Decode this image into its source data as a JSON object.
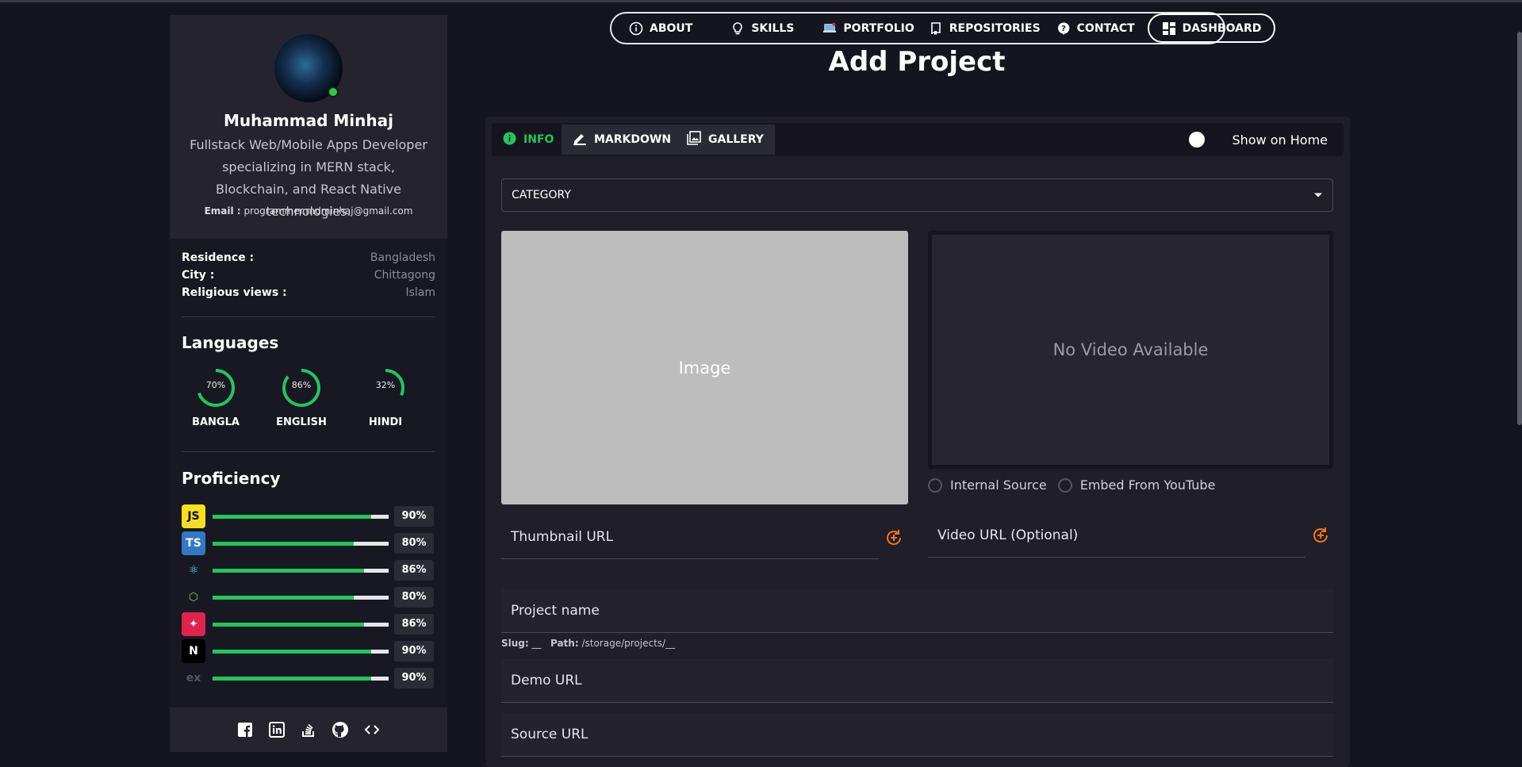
{
  "profile": {
    "name": "Muhammad Minhaj",
    "description": "Fullstack Web/Mobile Apps Developer specializing in MERN stack, Blockchain, and React Native technologies.",
    "email_label": "Email :",
    "email": "programmer.mdminhaj@gmail.com",
    "status": "online"
  },
  "details": [
    {
      "key": "Residence :",
      "value": "Bangladesh"
    },
    {
      "key": "City :",
      "value": "Chittagong"
    },
    {
      "key": "Religious views :",
      "value": "Islam"
    }
  ],
  "languages": {
    "title": "Languages",
    "items": [
      {
        "name": "BANGLA",
        "percent_label": "70%",
        "percent": 70
      },
      {
        "name": "ENGLISH",
        "percent_label": "86%",
        "percent": 86
      },
      {
        "name": "HINDI",
        "percent_label": "32%",
        "percent": 32
      }
    ]
  },
  "proficiency": {
    "title": "Proficiency",
    "items": [
      {
        "icon": "javascript-icon",
        "glyph": "JS",
        "color": "#f7df1e",
        "fg": "#000000",
        "percent_label": "90%",
        "percent": 90
      },
      {
        "icon": "typescript-icon",
        "glyph": "TS",
        "color": "#3178c6",
        "fg": "#ffffff",
        "percent_label": "80%",
        "percent": 80
      },
      {
        "icon": "react-icon",
        "glyph": "⚛",
        "color": "#181822",
        "fg": "#61dafb",
        "percent_label": "86%",
        "percent": 86
      },
      {
        "icon": "nodejs-icon",
        "glyph": "⬡",
        "color": "#181822",
        "fg": "#8cc84b",
        "percent_label": "80%",
        "percent": 80
      },
      {
        "icon": "nestjs-icon",
        "glyph": "✦",
        "color": "#e0234e",
        "fg": "#ffffff",
        "percent_label": "86%",
        "percent": 86
      },
      {
        "icon": "nextjs-icon",
        "glyph": "N",
        "color": "#000000",
        "fg": "#ffffff",
        "percent_label": "90%",
        "percent": 90
      },
      {
        "icon": "express-icon",
        "glyph": "ex",
        "color": "#181822",
        "fg": "#555560",
        "percent_label": "90%",
        "percent": 90
      }
    ]
  },
  "social": [
    "facebook-icon",
    "linkedin-icon",
    "stackoverflow-icon",
    "github-icon",
    "code-icon"
  ],
  "nav": {
    "items": [
      {
        "label": "ABOUT",
        "icon": "info-icon"
      },
      {
        "label": "SKILLS",
        "icon": "lightbulb-icon"
      },
      {
        "label": "PORTFOLIO",
        "icon": "laptop-icon"
      },
      {
        "label": "REPOSITORIES",
        "icon": "repository-icon"
      },
      {
        "label": "CONTACT",
        "icon": "help-icon"
      },
      {
        "label": "DASHBOARD",
        "icon": "dashboard-icon",
        "active": true
      }
    ]
  },
  "page_title": "Add Project",
  "tabs": [
    {
      "label": "INFO",
      "icon": "info-icon",
      "active": true
    },
    {
      "label": "MARKDOWN",
      "icon": "edit-icon"
    },
    {
      "label": "GALLERY",
      "icon": "gallery-icon"
    }
  ],
  "show_on_home": {
    "label": "Show on Home",
    "checked": false
  },
  "category": {
    "label": "CATEGORY"
  },
  "image_placeholder": "Image",
  "video_placeholder": "No Video Available",
  "video_source": [
    "Internal Source",
    "Embed From YouTube"
  ],
  "fields": {
    "thumbnail_url": "Thumbnail URL",
    "video_url": "Video URL (Optional)",
    "project_name": "Project name",
    "demo_url": "Demo URL",
    "source_url": "Source URL"
  },
  "slug": {
    "slug_label": "Slug:",
    "slug_value": "__",
    "path_label": "Path:",
    "path_value": "/storage/projects/__"
  },
  "colors": {
    "accent": "#22c55e",
    "background": "#151520",
    "card": "#1f1e29",
    "refresh": "#f97316"
  }
}
